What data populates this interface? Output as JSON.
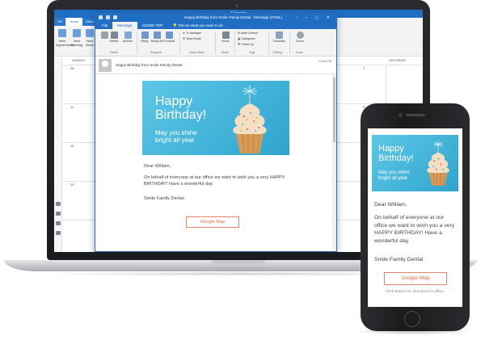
{
  "calendar": {
    "title": "Calendar",
    "tabs": [
      "File",
      "Home",
      "Send"
    ],
    "ribbon_groups": [
      "New Appointment",
      "New Meeting",
      "New Items"
    ],
    "day_headers": [
      "SUNDAY",
      "SATURDAY"
    ],
    "date_numbers": [
      "28",
      "11",
      "18",
      "25",
      "2",
      "9",
      "16",
      "23",
      "30"
    ]
  },
  "outlook": {
    "window_title": "Happy Birthday from Smile Family Dental  -  Message (HTML)",
    "tabs": [
      "File",
      "Message",
      "ADOBE PDF"
    ],
    "active_tab": "Message",
    "tell_me": "Tell me what you want to do",
    "ribbon": {
      "delete": "Delete",
      "archive": "Archive",
      "reply": "Reply",
      "reply_all": "Reply All",
      "forward": "Forward",
      "quick_steps": [
        "To Manager",
        "Team Email"
      ],
      "move": "Move",
      "mark_unread": "Mark Unread",
      "categorize": "Categorize",
      "follow_up": "Follow Up",
      "translate": "Translate",
      "zoom": "Zoom",
      "groups": [
        "Delete",
        "Respond",
        "Quick Steps",
        "Move",
        "Tags",
        "Editing",
        "Zoom"
      ]
    },
    "subject": "Happy Birthday from Smile Family Dental",
    "time": "12:09 PM"
  },
  "email": {
    "headline_line1": "Happy",
    "headline_line2": "Birthday!",
    "sub_line1": "May you shine",
    "sub_line2": "bright all year.",
    "greeting": "Dear William,",
    "body": "On behalf of everyone at our office we want to wish you a very HAPPY BIRTHDAY! Have a wonderful day.",
    "signature": "Smile Family Dental",
    "button_label": "Google Map",
    "button_note": "Click button for directions to office."
  },
  "colors": {
    "banner": "#3fb3dc",
    "outlook_blue": "#1f6ec4",
    "button_orange": "#e06a44"
  }
}
